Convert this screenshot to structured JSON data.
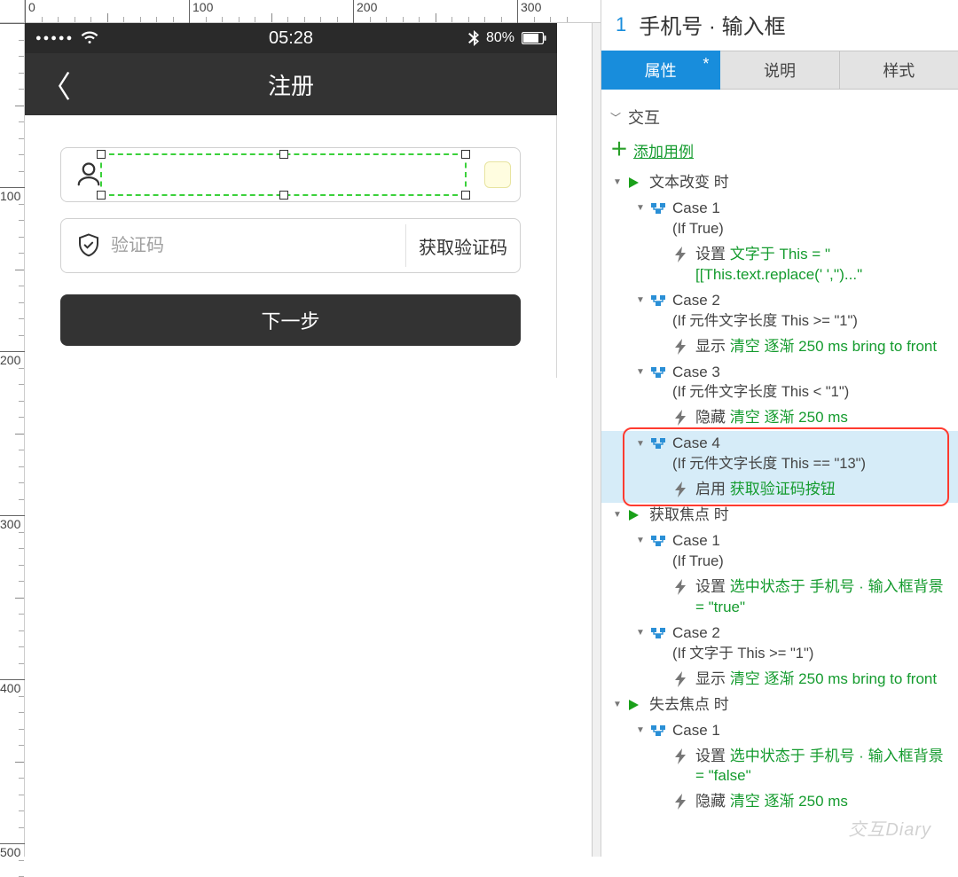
{
  "ruler": {
    "h": [
      "0",
      "100",
      "200",
      "300"
    ],
    "v": [
      "100",
      "200",
      "300",
      "400",
      "500"
    ]
  },
  "status_bar": {
    "time": "05:28",
    "battery": "80%"
  },
  "nav": {
    "title": "注册"
  },
  "form": {
    "code_placeholder": "验证码",
    "get_code_label": "获取验证码",
    "next_label": "下一步"
  },
  "inspector": {
    "index": "1",
    "title": "手机号 · 输入框",
    "tabs": {
      "props": "属性",
      "notes": "说明",
      "style": "样式"
    },
    "section": "交互",
    "add_case": "添加用例",
    "events": {
      "text_change": {
        "label": "文本改变 时",
        "cases": [
          {
            "name": "Case 1",
            "cond": "(If True)",
            "actions": [
              {
                "pre": "设置 ",
                "green": "文字于 This = \"[[This.text.replace(' ','')...\""
              }
            ]
          },
          {
            "name": "Case 2",
            "cond": "(If 元件文字长度 This >= \"1\")",
            "actions": [
              {
                "pre": "显示 ",
                "green": "清空 逐渐 250 ms bring to front"
              }
            ]
          },
          {
            "name": "Case 3",
            "cond": "(If 元件文字长度 This < \"1\")",
            "actions": [
              {
                "pre": "隐藏 ",
                "green": "清空 逐渐 250 ms"
              }
            ]
          },
          {
            "name": "Case 4",
            "cond": "(If 元件文字长度 This == \"13\")",
            "actions": [
              {
                "pre": "启用 ",
                "green": "获取验证码按钮"
              }
            ]
          }
        ]
      },
      "focus": {
        "label": "获取焦点 时",
        "cases": [
          {
            "name": "Case 1",
            "cond": "(If True)",
            "actions": [
              {
                "pre": "设置 ",
                "green": "选中状态于 手机号 · 输入框背景 = \"true\""
              }
            ]
          },
          {
            "name": "Case 2",
            "cond": "(If 文字于 This >= \"1\")",
            "actions": [
              {
                "pre": "显示 ",
                "green": "清空 逐渐 250 ms bring to front"
              }
            ]
          }
        ]
      },
      "blur": {
        "label": "失去焦点 时",
        "cases": [
          {
            "name": "Case 1",
            "cond": "",
            "actions": [
              {
                "pre": "设置 ",
                "green": "选中状态于 手机号 · 输入框背景 = \"false\""
              },
              {
                "pre": "隐藏 ",
                "green": "清空 逐渐 250 ms"
              }
            ]
          }
        ]
      }
    }
  },
  "watermark": "交互Diary"
}
